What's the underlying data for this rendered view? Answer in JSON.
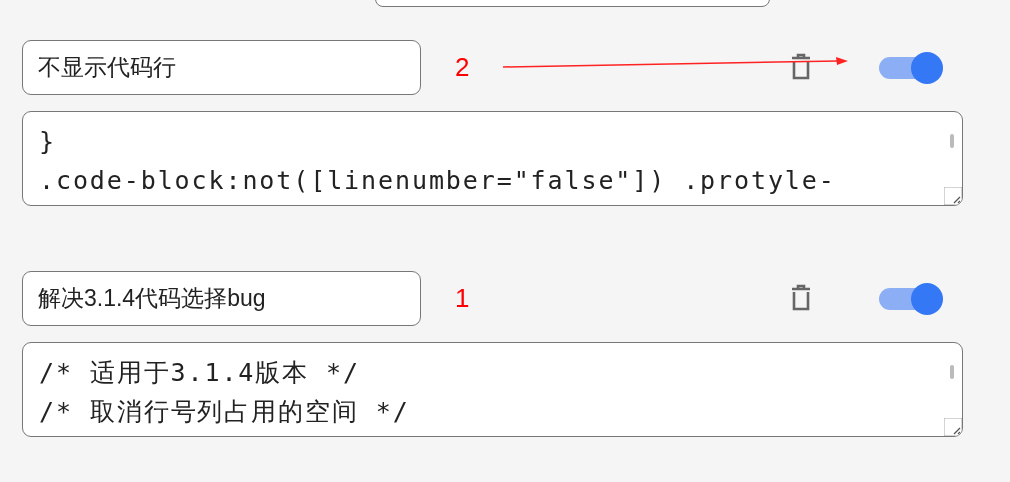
{
  "snippets": [
    {
      "name": "不显示代码行",
      "annotation": {
        "number": "2",
        "arrow": true
      },
      "enabled": true,
      "code_lines": [
        "}",
        ".code-block:not([linenumber=\"false\"]) .protyle-"
      ]
    },
    {
      "name": "解决3.1.4代码选择bug",
      "annotation": {
        "number": "1",
        "arrow": false
      },
      "enabled": true,
      "code_lines": [
        "/* 适用于3.1.4版本 */",
        "/* 取消行号列占用的空间 */"
      ]
    }
  ]
}
